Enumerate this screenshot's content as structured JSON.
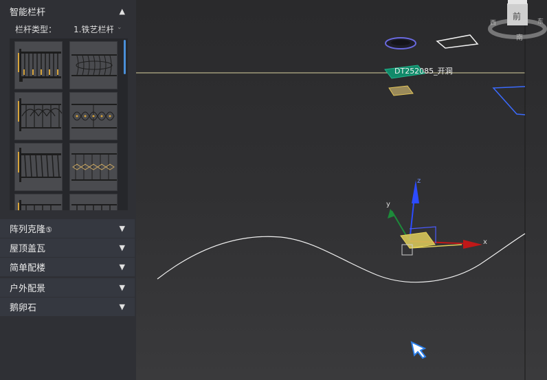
{
  "panel": {
    "section1": {
      "title": "智能栏杆",
      "expanded": true
    },
    "type_label": "栏杆类型：",
    "type_value": "1.铁艺栏杆",
    "thumbnails": [
      "railing-1",
      "railing-2",
      "railing-3",
      "railing-4",
      "railing-5",
      "railing-6",
      "railing-7",
      "railing-8"
    ],
    "sections": [
      {
        "title": "阵列克隆",
        "badge": "⑤"
      },
      {
        "title": "屋顶盖瓦",
        "badge": ""
      },
      {
        "title": "简单配楼",
        "badge": ""
      },
      {
        "title": "户外配景",
        "badge": ""
      },
      {
        "title": "鹅卵石",
        "badge": ""
      }
    ]
  },
  "viewport": {
    "object_label": "DT252085_开洞",
    "gizmo": {
      "x": "x",
      "y": "y",
      "z": "z"
    },
    "viewcube": {
      "left": "西",
      "front": "前",
      "bottom": "南",
      "right": "东"
    },
    "colors": {
      "x_axis": "#c01818",
      "y_axis": "#d8c84a",
      "z_axis": "#2c4bff",
      "selection": "#e6c85a",
      "object_green": "#118a6a"
    }
  }
}
